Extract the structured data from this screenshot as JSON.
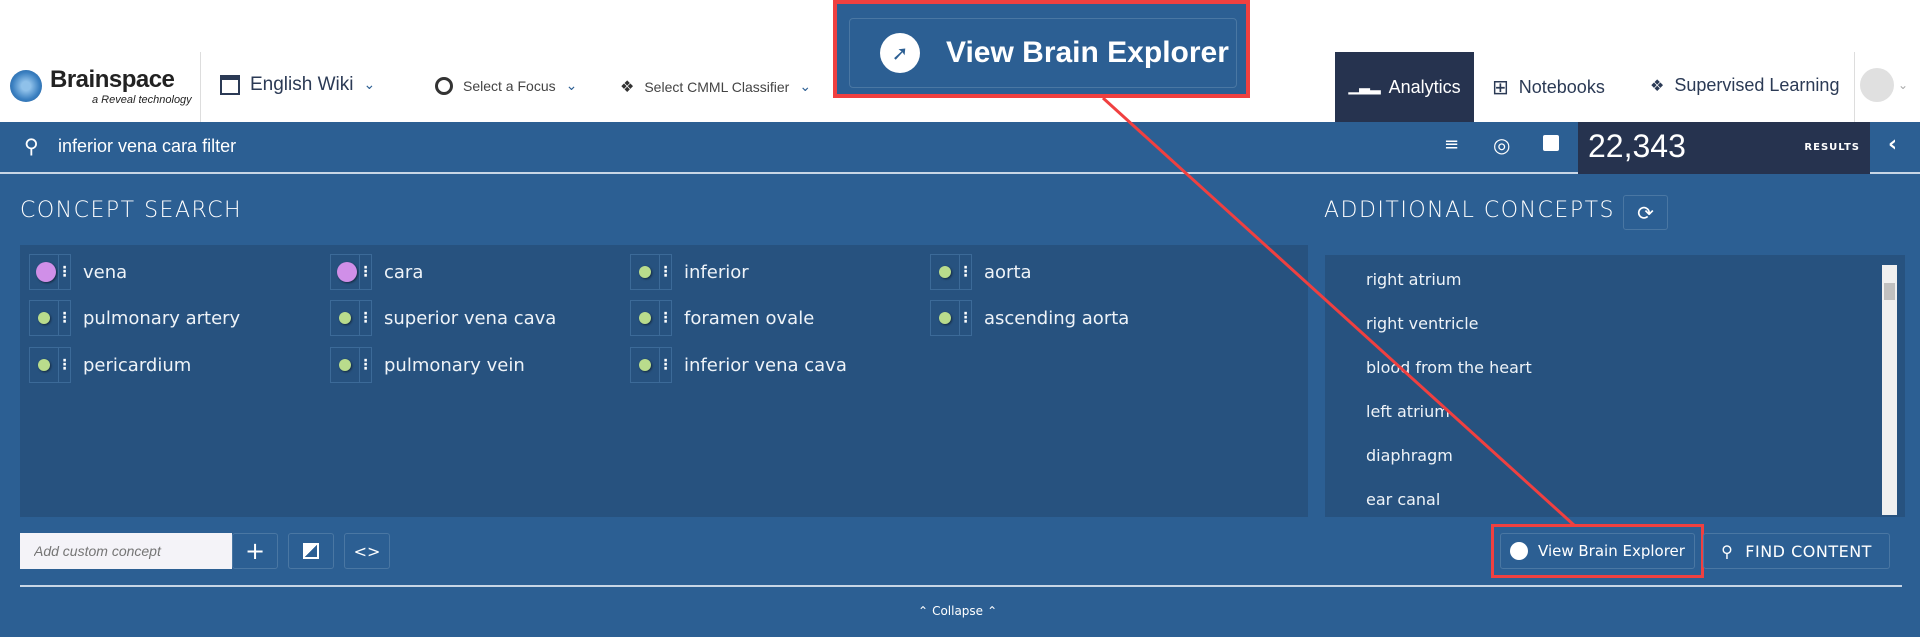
{
  "header": {
    "brand": "Brainspace",
    "brand_sub": "a Reveal technology",
    "dataset": "English Wiki",
    "focus": "Select a Focus",
    "classifier": "Select CMML Classifier",
    "nav": [
      {
        "label": "Analytics",
        "icon": "bar-chart-icon",
        "active": true
      },
      {
        "label": "Notebooks",
        "icon": "grid-icon"
      },
      {
        "label": "Supervised Learning",
        "icon": "network-icon"
      }
    ]
  },
  "callout": {
    "label": "View Brain Explorer"
  },
  "search": {
    "query": "inferior vena cara filter",
    "results_count": "22,343",
    "results_label": "RESULTS"
  },
  "concept_search": {
    "title": "CONCEPT SEARCH",
    "chips": [
      {
        "label": "vena",
        "color": "#d08fe8",
        "large": true
      },
      {
        "label": "cara",
        "color": "#d08fe8",
        "large": true
      },
      {
        "label": "inferior",
        "color": "#b9dc8c"
      },
      {
        "label": "aorta",
        "color": "#b9dc8c"
      },
      {
        "label": "pulmonary artery",
        "color": "#b9dc8c"
      },
      {
        "label": "superior vena cava",
        "color": "#b9dc8c"
      },
      {
        "label": "foramen ovale",
        "color": "#b9dc8c"
      },
      {
        "label": "ascending aorta",
        "color": "#b9dc8c"
      },
      {
        "label": "pericardium",
        "color": "#b9dc8c"
      },
      {
        "label": "pulmonary vein",
        "color": "#b9dc8c"
      },
      {
        "label": "inferior vena cava",
        "color": "#b9dc8c"
      }
    ],
    "custom_placeholder": "Add custom concept"
  },
  "additional": {
    "title": "ADDITIONAL CONCEPTS",
    "items": [
      "right atrium",
      "right ventricle",
      "blood from the heart",
      "left atrium",
      "diaphragm",
      "ear canal"
    ]
  },
  "actions": {
    "brain_explorer": "View Brain Explorer",
    "find_content": "FIND CONTENT",
    "collapse": "Collapse"
  },
  "colors": {
    "primary": "#2c5f93",
    "panel": "#27527f",
    "dark": "#26334f",
    "highlight": "#f04040"
  }
}
